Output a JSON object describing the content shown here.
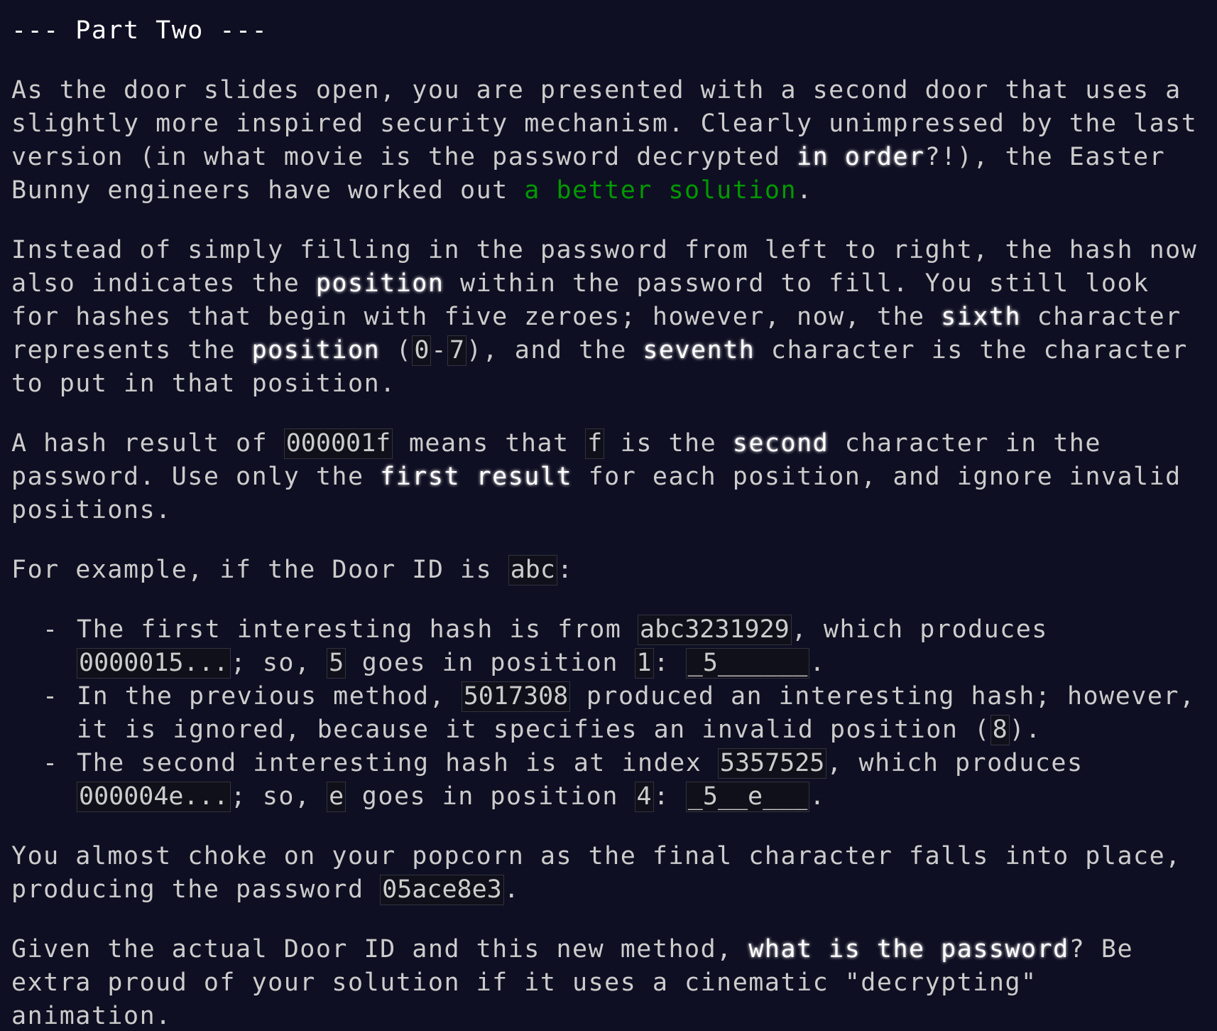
{
  "header": {
    "title": "--- Part Two ---"
  },
  "p1": {
    "t1": "As the door slides open, you are presented with a second door that uses a slightly more inspired security mechanism. Clearly unimpressed by the last version (in what movie is the password decrypted ",
    "em1": "in order",
    "t2": "?!), the Easter Bunny engineers have worked out ",
    "link": "a better solution",
    "t3": "."
  },
  "p2": {
    "t1": "Instead of simply filling in the password from left to right, the hash now also indicates the ",
    "em1": "position",
    "t2": " within the password to fill. You still look for hashes that begin with five zeroes; however, now, the ",
    "em2": "sixth",
    "t3": " character represents the ",
    "em3": "position",
    "t4": " (",
    "c1": "0",
    "t5": "-",
    "c2": "7",
    "t6": "), and the ",
    "em4": "seventh",
    "t7": " character is the character to put in that position."
  },
  "p3": {
    "t1": "A hash result of ",
    "c1": "000001f",
    "t2": " means that ",
    "c2": "f",
    "t3": " is the ",
    "em1": "second",
    "t4": " character in the password. Use only the ",
    "em2": "first result",
    "t5": " for each position, and ignore invalid positions."
  },
  "p4": {
    "t1": "For example, if the Door ID is ",
    "c1": "abc",
    "t2": ":"
  },
  "list": [
    {
      "t1": "The first interesting hash is from ",
      "c1": "abc3231929",
      "t2": ", which produces ",
      "c2": "0000015...",
      "t3": "; so, ",
      "c3": "5",
      "t4": " goes in position ",
      "c4": "1",
      "t5": ": ",
      "c5": "_5______",
      "t6": "."
    },
    {
      "t1": "In the previous method, ",
      "c1": "5017308",
      "t2": " produced an interesting hash; however, it is ignored, because it specifies an invalid position (",
      "c2": "8",
      "t3": ")."
    },
    {
      "t1": "The second interesting hash is at index ",
      "c1": "5357525",
      "t2": ", which produces ",
      "c2": "000004e...",
      "t3": "; so, ",
      "c3": "e",
      "t4": " goes in position ",
      "c4": "4",
      "t5": ": ",
      "c5": "_5__e___",
      "t6": "."
    }
  ],
  "p5": {
    "t1": "You almost choke on your popcorn as the final character falls into place, producing the password ",
    "c1": "05ace8e3",
    "t2": "."
  },
  "p6": {
    "t1": "Given the actual Door ID and this new method, ",
    "em1": "what is the password",
    "t2": "? Be extra proud of your solution if it uses a cinematic \"decrypting\" animation."
  },
  "colors": {
    "background": "#0f0f23",
    "text": "#cccccc",
    "emphasis": "#ffffff",
    "link": "#009900",
    "code_border": "#333340"
  }
}
